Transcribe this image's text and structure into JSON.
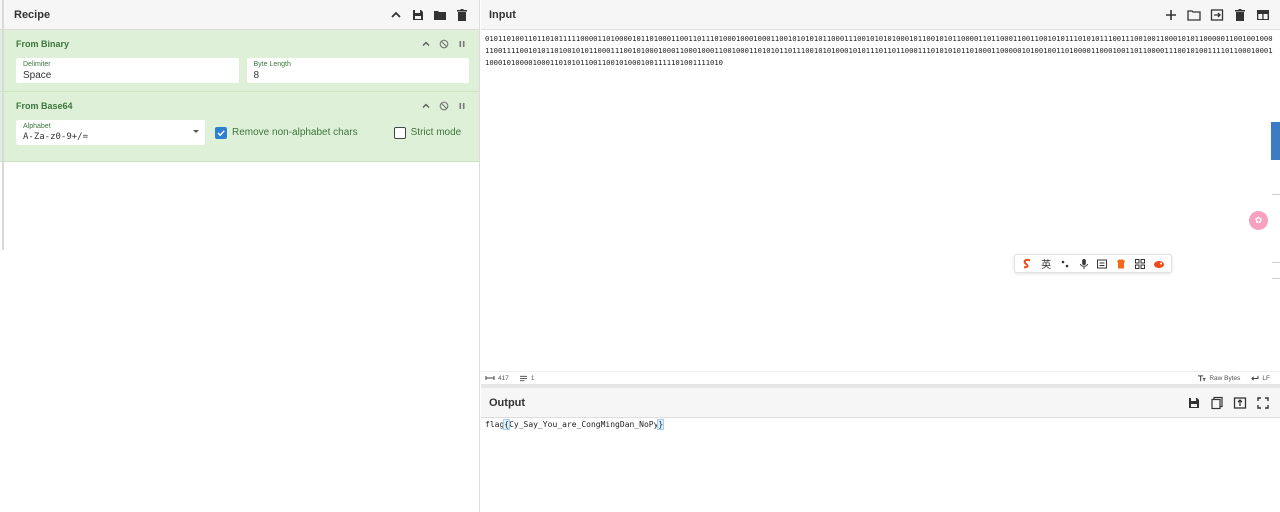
{
  "recipe": {
    "title": "Recipe",
    "operations": [
      {
        "title": "From Binary",
        "fields": [
          {
            "label": "Delimiter",
            "value": "Space"
          },
          {
            "label": "Byte Length",
            "value": "8"
          }
        ]
      },
      {
        "title": "From Base64",
        "alphabet": {
          "label": "Alphabet",
          "value": "A-Za-z0-9+/="
        },
        "remove_nonalpha": {
          "label": "Remove non-alphabet chars",
          "checked": true
        },
        "strict_mode": {
          "label": "Strict mode",
          "checked": false
        }
      }
    ]
  },
  "input": {
    "title": "Input",
    "text": "01011010011011010111110000110100001011010001100110111010001000100011001010101011000111001010101000101100101011000011011000110011001010111010101110011100100110001010110000011001001000110011110010101101001010110001110010100010001100010001100100011010101101110010101000101011101101100011101010101101000110000010100100110100001100010011011000011100101001111011000100011000101000010001101010110011001010001001111101001111010",
    "status": {
      "length": "417",
      "lines": "1",
      "format": "Raw Bytes",
      "eol": "LF"
    }
  },
  "output": {
    "title": "Output",
    "text_prefix": "flag",
    "text_open": "{",
    "text_body": "Cy_Say_You_are_CongMingDan_NoPy",
    "text_close": "}"
  },
  "ime_toolbar": {
    "lang_label": "英"
  },
  "colors": {
    "accent_green": "#3c763d",
    "op_background": "#dff0d8",
    "checkbox_blue": "#2f7fd0"
  }
}
